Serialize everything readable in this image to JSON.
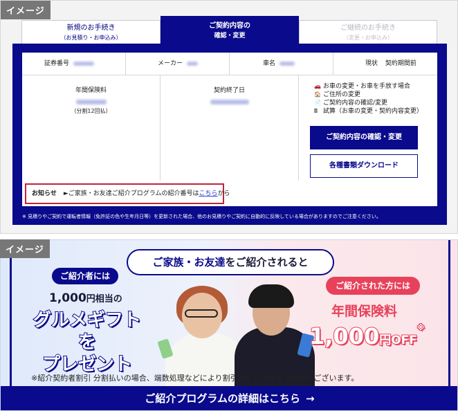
{
  "panel1": {
    "tag": "イメージ",
    "tabs": [
      {
        "label": "新規のお手続き",
        "sub": "（お見積り・お申込み）"
      },
      {
        "label": "ご契約内容の",
        "sub": "確認・変更"
      },
      {
        "label": "ご継続のお手続き",
        "sub": "（変更・お申込み）"
      }
    ],
    "info": {
      "policy_label": "証券番号",
      "maker_label": "メーカー",
      "model_label": "車名",
      "status_label": "現状",
      "status_value": "契約期間前"
    },
    "premium": {
      "label": "年間保険料",
      "detail": "（分割12回払）"
    },
    "end_date": {
      "label": "契約終了日"
    },
    "links": [
      {
        "icon": "car-icon",
        "glyph": "🚗",
        "label": "お車の変更・お車を手放す場合"
      },
      {
        "icon": "home-icon",
        "glyph": "🏠",
        "label": "ご住所の変更"
      },
      {
        "icon": "document-icon",
        "glyph": "📄",
        "label": "ご契約内容の確認/変更"
      },
      {
        "icon": "calculator-icon",
        "glyph": "🖩",
        "label": "試算（お車の変更・契約内容変更）"
      }
    ],
    "buttons": {
      "primary": "ご契約内容の確認・変更",
      "download": "各種書類ダウンロード"
    },
    "notice": {
      "heading": "お知らせ",
      "prefix": "►ご家族・お友達ご紹介プログラムの紹介番号は",
      "link": "こちら",
      "suffix": "から"
    },
    "footnote": "※ 見積りやご契約で運転者情報（免許証の色や生年月日等）を更新された場合、他のお見積りやご契約に自動的に反映している場合がありますのでご注意ください。"
  },
  "panel2": {
    "tag": "イメージ",
    "headline_highlight": "ご家族・お友達",
    "headline_rest": "をご紹介されると",
    "referrer_pill": "ご紹介者には",
    "referrer_amount": "1,000",
    "referrer_amount_unit": "円相当の",
    "gift_line1": "グルメギフトを",
    "gift_line2": "プレゼント",
    "referee_pill": "ご紹介された方には",
    "referee_title": "年間保険料",
    "referee_amount": "1,000",
    "referee_unit": "円OFF",
    "referee_asterisk": "※",
    "disclaimer": "※紹介契約者割引 分割払いの場合、端数処理などにより割引額が若干異なる場合がございます。",
    "cta": "ご紹介プログラムの詳細はこちら",
    "cta_arrow": "→",
    "colors": {
      "navy": "#0a0a8c",
      "pink": "#e8415b",
      "notice_border": "#c0243a"
    }
  }
}
